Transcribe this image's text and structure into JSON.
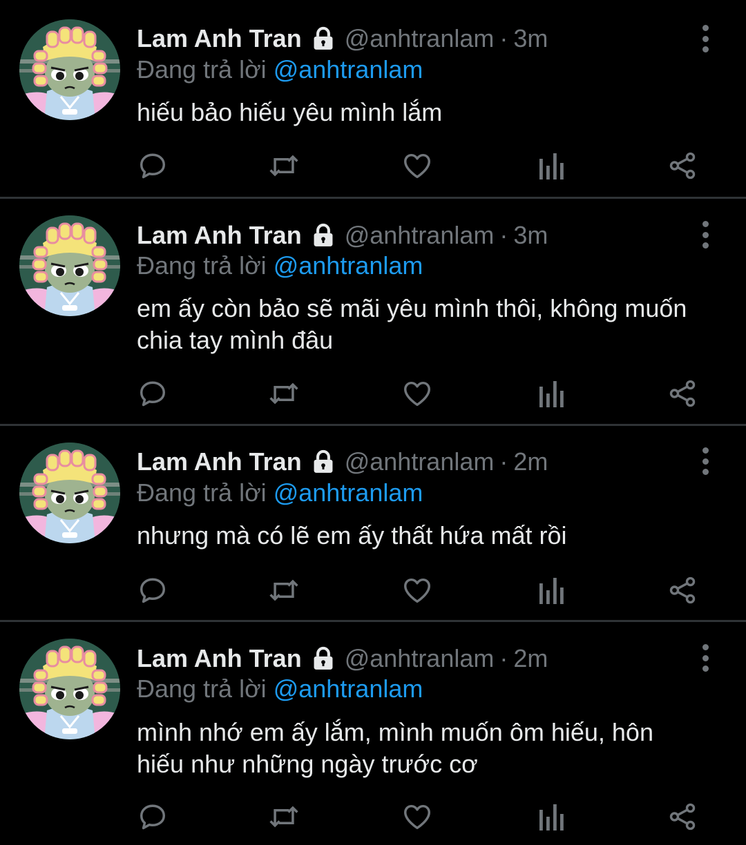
{
  "theme": {
    "background": "#000000",
    "text": "#e7e9ea",
    "muted": "#71767b",
    "link": "#1d9bf0",
    "divider": "#2f3336"
  },
  "tweets": [
    {
      "name": "Lam Anh Tran",
      "handle": "@anhtranlam",
      "separator": "·",
      "time": "3m",
      "reply_prefix": "Đang trả lời",
      "reply_handle": "@anhtranlam",
      "text": "hiếu bảo hiếu yêu mình lắm"
    },
    {
      "name": "Lam Anh Tran",
      "handle": "@anhtranlam",
      "separator": "·",
      "time": "3m",
      "reply_prefix": "Đang trả lời",
      "reply_handle": "@anhtranlam",
      "text": "em ấy còn bảo sẽ mãi yêu mình thôi, không muốn chia tay mình đâu"
    },
    {
      "name": "Lam Anh Tran",
      "handle": "@anhtranlam",
      "separator": "·",
      "time": "2m",
      "reply_prefix": "Đang trả lời",
      "reply_handle": "@anhtranlam",
      "text": "nhưng mà có lẽ em ấy thất hứa mất rồi"
    },
    {
      "name": "Lam Anh Tran",
      "handle": "@anhtranlam",
      "separator": "·",
      "time": "2m",
      "reply_prefix": "Đang trả lời",
      "reply_handle": "@anhtranlam",
      "text": "mình nhớ em ấy lắm, mình muốn ôm hiếu, hôn hiếu như những ngày trước cơ"
    }
  ],
  "icons": {
    "lock": "lock-icon",
    "more": "more-vertical-icon",
    "reply": "reply-icon",
    "retweet": "retweet-icon",
    "like": "heart-icon",
    "views": "views-icon",
    "share": "share-icon"
  }
}
